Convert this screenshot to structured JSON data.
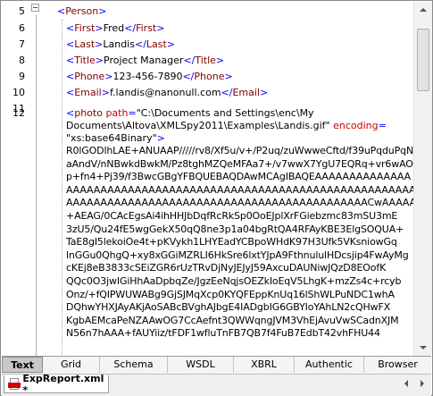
{
  "editor": {
    "line_numbers": [
      "5",
      "6",
      "7",
      "8",
      "9",
      "10",
      "11",
      "12"
    ],
    "person_open": "<Person>",
    "person_name": "Person",
    "lines": [
      {
        "tag": "First",
        "value": "Fred"
      },
      {
        "tag": "Last",
        "value": "Landis"
      },
      {
        "tag": "Title",
        "value": "Project Manager"
      },
      {
        "tag": "Phone",
        "value": "123-456-7890"
      },
      {
        "tag": "Email",
        "value": "f.landis@nanonull.com"
      }
    ],
    "photo": {
      "tag": "photo",
      "attr1_name": "path",
      "attr1_value_part1": "\"C:\\Documents and Settings\\enc\\My",
      "attr1_value_part2": "Documents\\Altova\\XMLSpy2011\\Examples\\Landis.gif\"",
      "attr2_name": "encoding",
      "attr2_value": "\"xs:base64Binary\"",
      "close": ">"
    },
    "base64_lines": [
      "R0lGODlhLAE+ANUAAP/////rv8/Xf5u/v+/P2uq/zuWwweCftd/f39uPqduPqN",
      "aAndV/nNBwkdBwkM/Pz8tghMZQeMFAa7+/v7wwX7YgU7EQRq+vr6wAO",
      "p+fn4+Pj39/f3BwcGBgYFBQUEBAQDAwMCAgIBAQEAAAAAAAAAAAAAA",
      "AAAAAAAAAAAAAAAAAAAAAAAAAAAAAAAAAAAAAAAAAAAAAAAAAAAAAAAA",
      "AAAAAAAAAAAAAAAAAAAAAAAAAAAAAAAAAAAAAAAAAAAACwAAAAALAE",
      "+AEAG/0CAcEgsAi4ihHHJbDqfRcRkSp0OoEJplXrFGiebzmc83mSU3mE",
      "3zU5/Qu24fE5wgGekX50qQ8ne3p1a04bgRtQA4RFAyKBE3ElgSOQUA+",
      "TaE8gI5lekoiOe4t+pKVykh1LHYEadYCBpoWHdK97H3Ufk5VKsniowGq",
      "lnGGu0QhgQ+xy8xGGiMZRLI6HkSre6lxtYJpA9FthnululHDcsjip4FwAyMg",
      "cKEj8eB3833cSEiZGR6rUzTRvDjNyJEJyJ59AxcuDAUNiwJQzD8EOofK",
      "QQc0O3jwIGiHhAaDpbqZe/JgzEeNqjsOEZkIoEqV5LhgK+mzZs4c+rcyb",
      "Onz/+fQIPWUWABg9GjSJMqXcp0KYQFEppKnUq16lShWLPuNDC1whA",
      "DQhwYHXJAyAKjAoSABcBVghAJbgE4IADgbIG6GBYIoYAhLN2cQHwFX",
      "KgbAEMcaPeNZAAwOG7CcAefnt3QWWqngJVM3VhEjAvuVwSCadnXJM",
      "N56n7hAAA+fAUYiiz/tFDF1wfluTnFB7QB7f4FuB7EdbT42vhFHU44"
    ]
  },
  "view_tabs": [
    "Text",
    "Grid",
    "Schema",
    "WSDL",
    "XBRL",
    "Authentic",
    "Browser"
  ],
  "active_view_tab": "Text",
  "file_tab": {
    "name": "ExpReport.xml *"
  },
  "colors": {
    "element_name": "#800000",
    "bracket": "#0000ff",
    "attribute_name": "#cc0000",
    "attribute_value": "#0000ff"
  }
}
